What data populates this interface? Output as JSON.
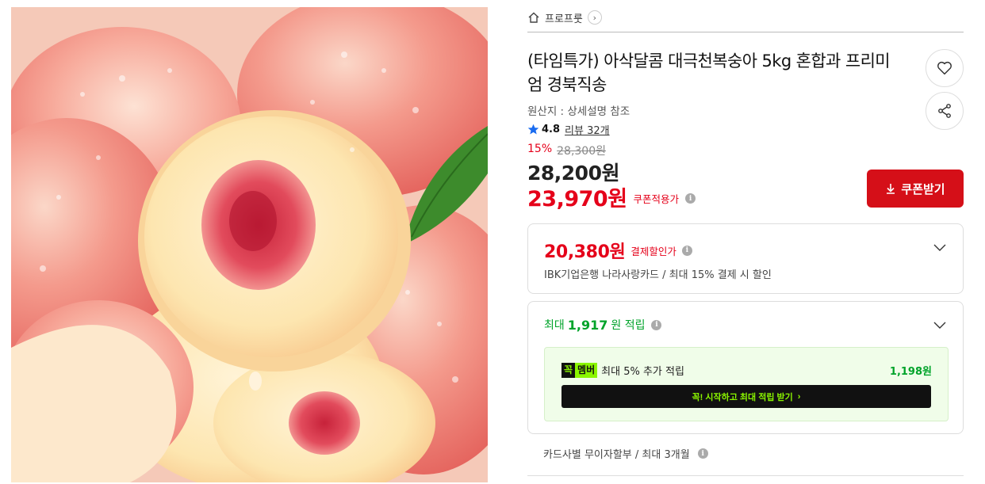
{
  "product_image": {
    "alt_icon": "peach-photo"
  },
  "breadcrumb": {
    "icon": "home-icon",
    "label": "프로프룻",
    "arrow": "›"
  },
  "product": {
    "title": "(타임특가) 아삭달콤 대극천복숭아 5kg 혼합과 프리미엄 경북직송",
    "origin": "원산지 : 상세설명 참조",
    "rating": "4.8",
    "reviews": "리뷰 32개"
  },
  "price": {
    "discount_rate": "15%",
    "original": "28,300원",
    "sale": "28,200원",
    "coupon_price": "23,970원",
    "coupon_label": "쿠폰적용가",
    "coupon_button": "쿠폰받기"
  },
  "card_discount": {
    "price": "20,380원",
    "label": "결제할인가",
    "desc": "IBK기업은행 나라사랑카드 / 최대 15% 결제 시 할인"
  },
  "points": {
    "prefix": "최대",
    "amount": "1,917",
    "suffix": "원 적립",
    "member_badge_1": "꼭",
    "member_badge_2": "멤버",
    "member_text": "최대 5% 추가 적립",
    "member_amount": "1,198원",
    "member_cta": "꼭! 시작하고 최대 적립 받기",
    "member_cta_arrow": "›"
  },
  "installment": {
    "text": "카드사별 무이자할부 / 최대 3개월"
  },
  "colors": {
    "accent_red": "#e5001a",
    "green": "#00a32a",
    "lime": "#8af500"
  }
}
